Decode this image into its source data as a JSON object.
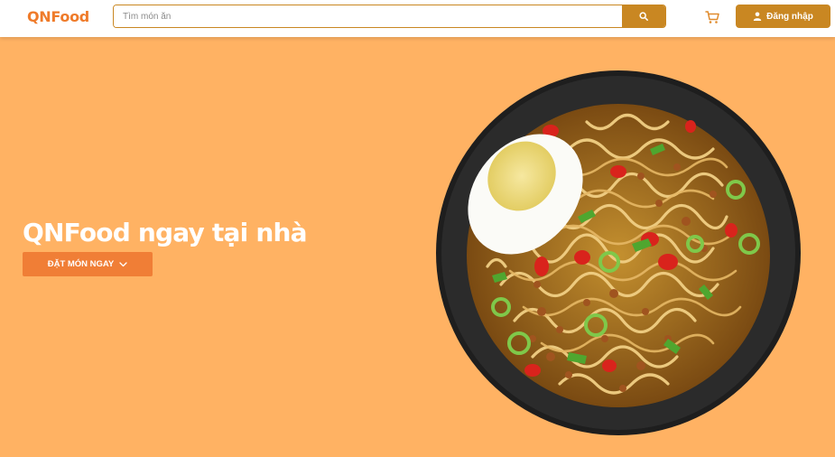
{
  "header": {
    "logo": "QNFood",
    "search": {
      "placeholder": "Tìm món ăn",
      "value": ""
    },
    "search_button_icon": "search-icon",
    "cart_icon": "cart-icon",
    "login_label": "Đăng nhập",
    "login_icon": "user-icon"
  },
  "hero": {
    "title": "QNFood ngay tại nhà",
    "order_button_label": "ĐẶT MÓN NGAY",
    "order_button_icon": "chevron-down-icon",
    "image": "noodle-bowl-image"
  },
  "colors": {
    "background": "#ffb263",
    "accent": "#c98722",
    "logo": "#ef7b2a",
    "cta": "#f07e36"
  }
}
